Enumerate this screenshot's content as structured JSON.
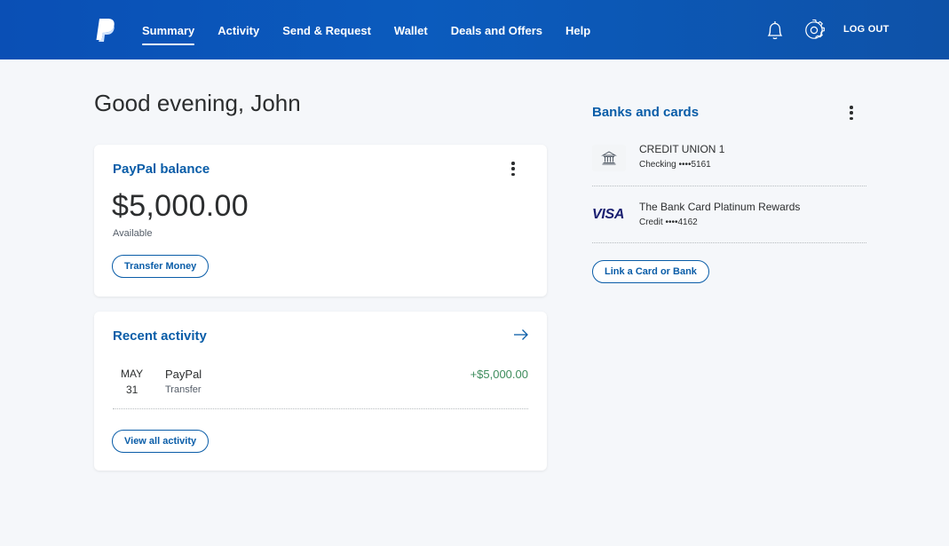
{
  "nav": {
    "items": [
      {
        "label": "Summary",
        "active": true
      },
      {
        "label": "Activity"
      },
      {
        "label": "Send & Request"
      },
      {
        "label": "Wallet"
      },
      {
        "label": "Deals and Offers"
      },
      {
        "label": "Help"
      }
    ],
    "logout_label": "LOG OUT",
    "icons": [
      "paypal-logo-icon",
      "bell-icon",
      "gear-icon"
    ]
  },
  "greeting": "Good evening, John",
  "balance": {
    "title": "PayPal balance",
    "amount": "$5,000.00",
    "sub": "Available",
    "button": "Transfer Money"
  },
  "activity": {
    "title": "Recent activity",
    "items": [
      {
        "month": "MAY",
        "day": "31",
        "name": "PayPal",
        "type": "Transfer",
        "amount": "+$5,000.00"
      }
    ],
    "button": "View all activity"
  },
  "banks": {
    "title": "Banks and cards",
    "items": [
      {
        "name": "CREDIT UNION 1",
        "detail": "Checking ••••5161",
        "icon": "bank-icon"
      },
      {
        "name": "The Bank Card Platinum Rewards",
        "detail": "Credit ••••4162",
        "icon_text": "VISA"
      }
    ],
    "button": "Link a Card or Bank"
  },
  "colors": {
    "brand_blue": "#0a4fb5",
    "link_blue": "#0a5da8",
    "positive_green": "#3d8c5c",
    "background": "#f5f7fa"
  }
}
